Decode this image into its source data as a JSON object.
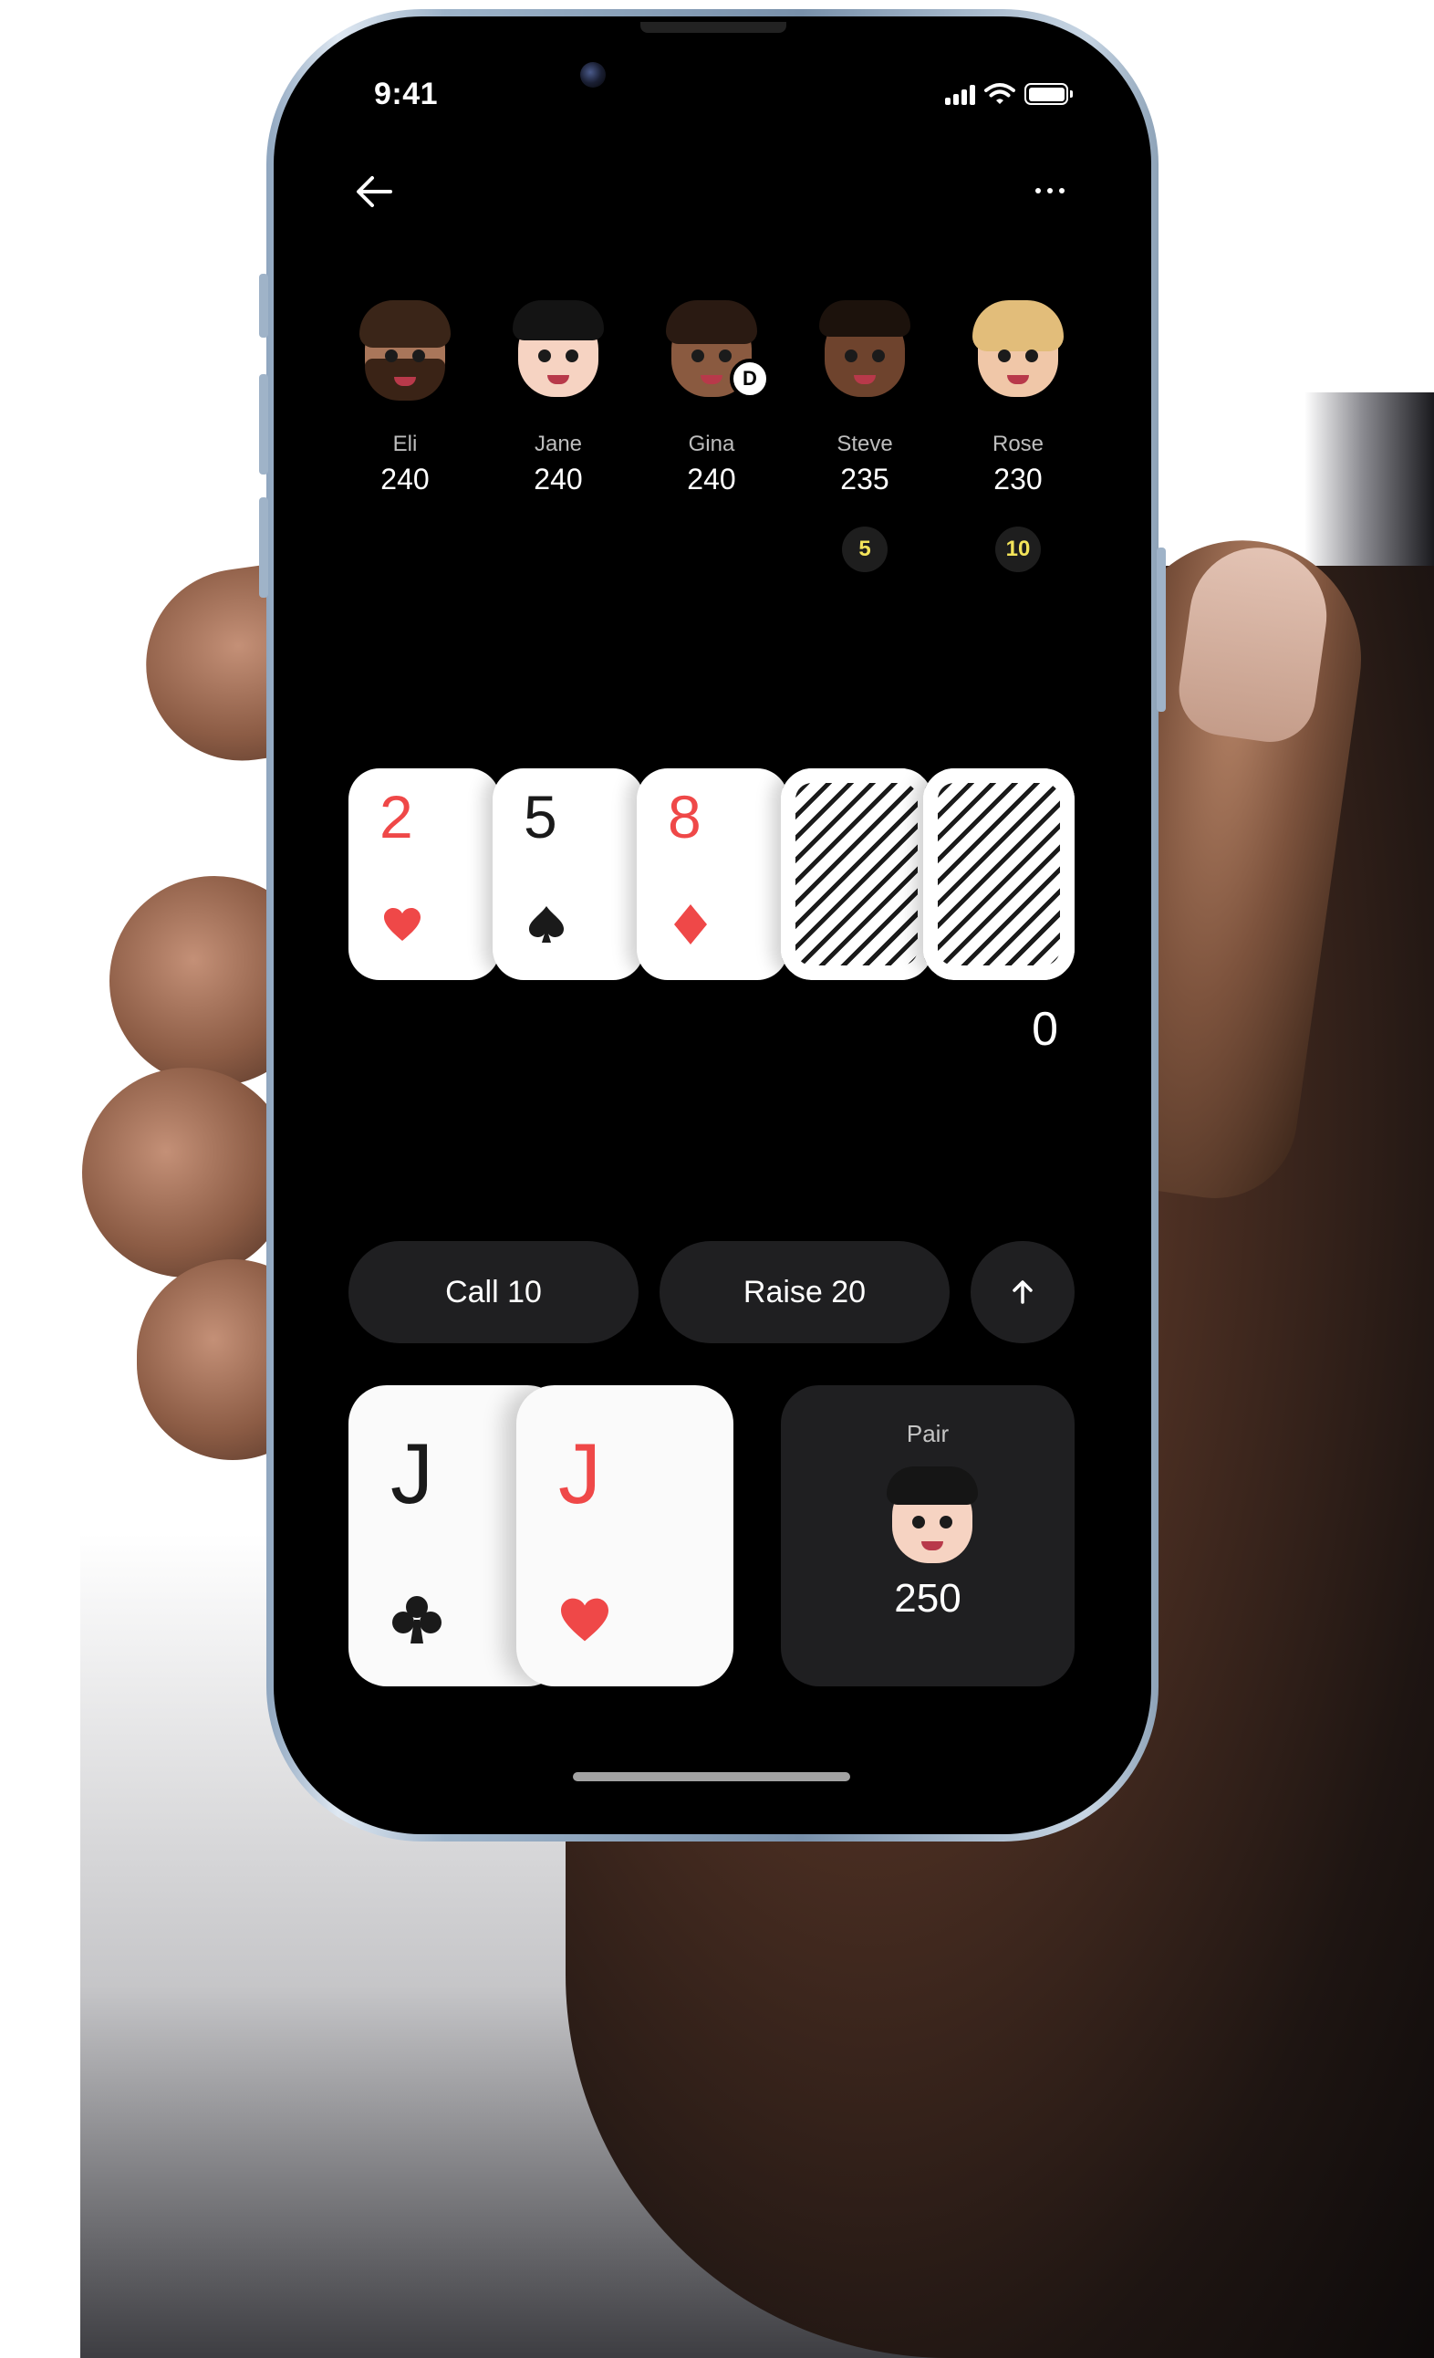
{
  "status_bar": {
    "time": "9:41"
  },
  "header": {
    "back_icon": "arrow-left-icon",
    "more_icon": "more-horizontal-icon"
  },
  "players": [
    {
      "name": "Eli",
      "stack": "240",
      "avatar": "memoji-man-beard"
    },
    {
      "name": "Jane",
      "stack": "240",
      "avatar": "memoji-woman-black-hair"
    },
    {
      "name": "Gina",
      "stack": "240",
      "avatar": "memoji-woman-dark",
      "dealer": "D"
    },
    {
      "name": "Steve",
      "stack": "235",
      "avatar": "memoji-man-dark",
      "bet": "5"
    },
    {
      "name": "Rose",
      "stack": "230",
      "avatar": "memoji-woman-blonde",
      "bet": "10"
    }
  ],
  "board": {
    "cards": [
      {
        "rank": "2",
        "suit": "hearts",
        "color": "#ef4848"
      },
      {
        "rank": "5",
        "suit": "spades",
        "color": "#1a1a1a"
      },
      {
        "rank": "8",
        "suit": "diamonds",
        "color": "#ef4848"
      },
      {
        "face_down": true
      },
      {
        "face_down": true
      }
    ],
    "pot": "0"
  },
  "actions": {
    "call_label": "Call 10",
    "raise_label": "Raise 20",
    "up_icon": "arrow-up-icon"
  },
  "my_hand": {
    "cards": [
      {
        "rank": "J",
        "suit": "clubs",
        "color": "#1a1a1a"
      },
      {
        "rank": "J",
        "suit": "hearts",
        "color": "#ef4848"
      }
    ],
    "hand_name": "Pair",
    "chips": "250",
    "avatar": "memoji-boy"
  },
  "colors": {
    "background": "#000000",
    "surface": "#1f1f21",
    "red_suit": "#ef4848",
    "bet_chip_text": "#f3e45a"
  }
}
